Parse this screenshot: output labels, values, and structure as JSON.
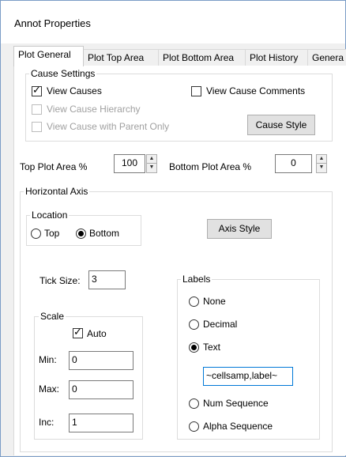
{
  "window": {
    "title": "Annot Properties"
  },
  "tabs": [
    {
      "label": "Plot General",
      "active": true
    },
    {
      "label": "Plot Top Area"
    },
    {
      "label": "Plot Bottom Area"
    },
    {
      "label": "Plot History"
    },
    {
      "label": "Genera"
    }
  ],
  "cause_settings": {
    "title": "Cause Settings",
    "view_causes": {
      "label": "View Causes",
      "checked": true
    },
    "view_cause_comments": {
      "label": "View Cause Comments",
      "checked": false
    },
    "view_cause_hierarchy": {
      "label": "View Cause Hierarchy",
      "checked": false,
      "disabled": true
    },
    "view_cause_parent_only": {
      "label": "View Cause with Parent Only",
      "checked": false,
      "disabled": true
    },
    "cause_style_button": "Cause Style"
  },
  "plot_area": {
    "top_label": "Top Plot Area %",
    "top_value": "100",
    "bottom_label": "Bottom Plot Area %",
    "bottom_value": "0"
  },
  "horizontal_axis": {
    "title": "Horizontal Axis",
    "location": {
      "title": "Location",
      "top_label": "Top",
      "bottom_label": "Bottom",
      "selected": "Bottom"
    },
    "axis_style_button": "Axis Style",
    "tick_size_label": "Tick Size:",
    "tick_size_value": "3",
    "scale": {
      "title": "Scale",
      "auto_label": "Auto",
      "auto_checked": true,
      "min_label": "Min:",
      "min_value": "0",
      "max_label": "Max:",
      "max_value": "0",
      "inc_label": "Inc:",
      "inc_value": "1"
    },
    "labels": {
      "title": "Labels",
      "options": [
        "None",
        "Decimal",
        "Text",
        "Num Sequence",
        "Alpha Sequence"
      ],
      "selected": "Text",
      "text_value": "~cellsamp,label~"
    }
  },
  "colors": {
    "focus_border": "#0078d7",
    "disabled_text": "#a0a0a0"
  }
}
